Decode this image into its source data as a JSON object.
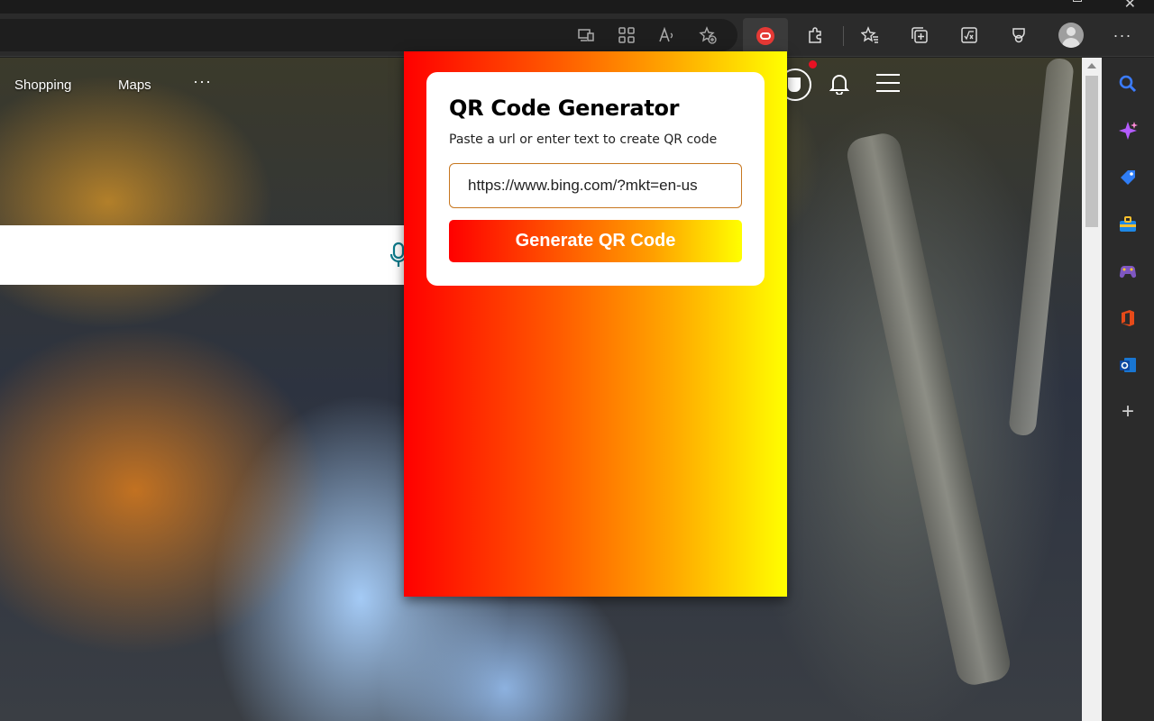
{
  "page_nav": {
    "shopping": "Shopping",
    "maps": "Maps",
    "more": "···"
  },
  "extension": {
    "title": "QR Code Generator",
    "subtitle": "Paste a url or enter text to create QR code",
    "input_value": "https://www.bing.com/?mkt=en-us",
    "button_label": "Generate QR Code"
  },
  "toolbar": {
    "more_label": "···"
  },
  "sidebar": {
    "add_label": "+"
  },
  "icons": {
    "toolbar": [
      "app-available-icon",
      "apps-grid-icon",
      "read-aloud-icon",
      "add-favorite-icon",
      "qr-extension-icon",
      "extensions-icon",
      "favorites-icon",
      "collections-icon",
      "math-solver-icon",
      "browser-essentials-icon",
      "profile-avatar-icon",
      "more-options-icon"
    ],
    "sidebar": [
      "search-icon",
      "copilot-icon",
      "shopping-tag-icon",
      "tools-icon",
      "games-icon",
      "office-icon",
      "outlook-icon",
      "add-icon"
    ]
  },
  "colors": {
    "popup_gradient_start": "#ff0000",
    "popup_gradient_end": "#ffff00",
    "input_border": "#c7771f",
    "toolbar_bg": "#2b2b2b"
  }
}
